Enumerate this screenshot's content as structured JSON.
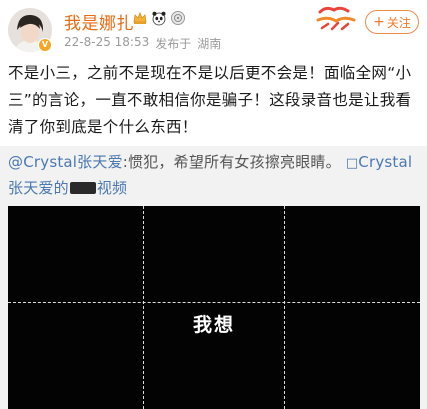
{
  "header": {
    "username": "我是娜扎",
    "verified_badge": "V",
    "date": "22-8-25 18:53",
    "source_prefix": "发布于",
    "location": "湖南",
    "follow_label": "关注",
    "badge_icons": [
      "crown-icon",
      "panda-icon",
      "vip-icon"
    ],
    "username_color": "#ea6a12",
    "accent_color": "#f07a2a"
  },
  "post": {
    "text": "不是小三，之前不是现在不是以后更不会是！面临全网“小三”的言论，一直不敢相信你是骗子！这段录音也是让我看清了你到底是个什么东西！"
  },
  "repost": {
    "mention": "@Crystal张天爱",
    "text": ":惯犯，希望所有女孩擦亮眼睛。",
    "link_icon": "video-link-icon",
    "link_text_1": "Crystal",
    "link_text_2": "张天爱的",
    "link_text_3": "视频",
    "link_color": "#4a78b0"
  },
  "video": {
    "caption": "我想"
  }
}
